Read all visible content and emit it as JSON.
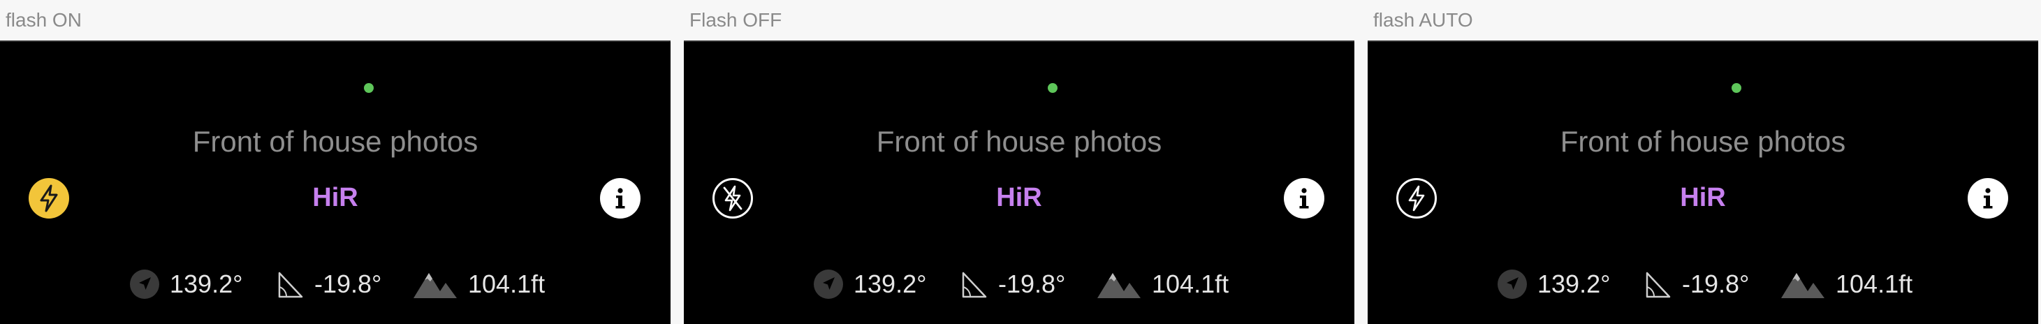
{
  "panels": [
    {
      "caption": "flash ON",
      "title": "Front of house photos",
      "mode_label": "HiR",
      "flash_state": "on",
      "flash_icon": "flash-on-icon",
      "heading": "139.2°",
      "tilt": "-19.8°",
      "altitude": "104.1ft"
    },
    {
      "caption": "Flash OFF",
      "title": "Front of house photos",
      "mode_label": "HiR",
      "flash_state": "off",
      "flash_icon": "flash-off-icon",
      "heading": "139.2°",
      "tilt": "-19.8°",
      "altitude": "104.1ft"
    },
    {
      "caption": "flash AUTO",
      "title": "Front of house photos",
      "mode_label": "HiR",
      "flash_state": "auto",
      "flash_icon": "flash-auto-icon",
      "heading": "139.2°",
      "tilt": "-19.8°",
      "altitude": "104.1ft"
    }
  ],
  "icons": {
    "status": "status-dot",
    "info": "info-icon",
    "heading": "navigation-arrow-icon",
    "tilt": "angle-icon",
    "altitude": "mountain-icon"
  },
  "colors": {
    "screen_bg": "#000000",
    "status_dot": "#5ec65a",
    "flash_on_bg": "#f2c53a",
    "mode_label": "#c680ee",
    "title": "#8e8e8e",
    "readout_text": "#e6e6e6",
    "caption": "#8a8a8a"
  }
}
